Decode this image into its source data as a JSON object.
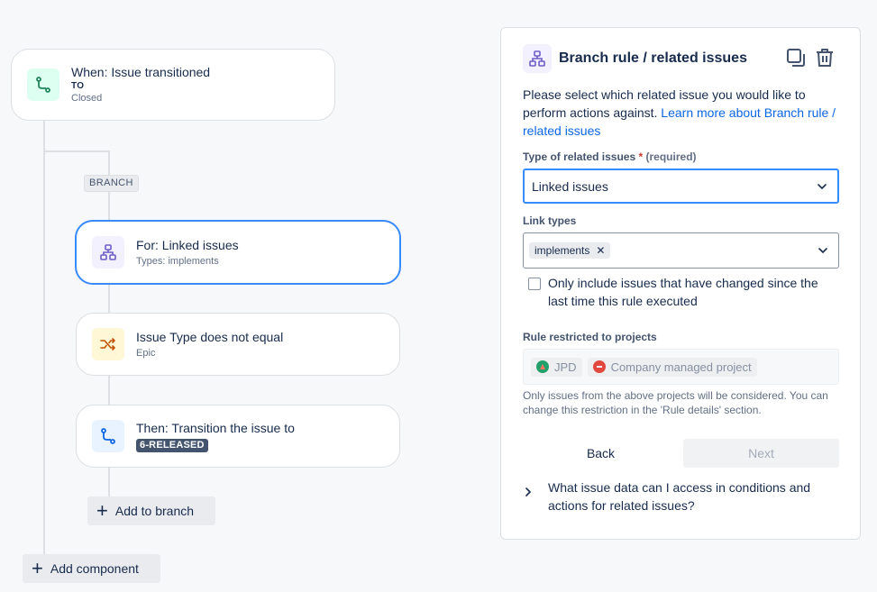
{
  "flow": {
    "trigger": {
      "title": "When: Issue transitioned",
      "to": "TO",
      "status": "Closed"
    },
    "branch_tag": "BRANCH",
    "branch_card": {
      "title": "For: Linked issues",
      "sub": "Types: implements"
    },
    "condition_card": {
      "title": "Issue Type does not equal",
      "sub": "Epic"
    },
    "action_card": {
      "title": "Then: Transition the issue to",
      "lozenge": "6-RELEASED"
    },
    "add_to_branch": "Add to branch",
    "add_component": "Add component"
  },
  "panel": {
    "title": "Branch rule / related issues",
    "description": "Please select which related issue you would like to perform actions against.",
    "learn_more": "Learn more about Branch rule / related issues",
    "type_label": "Type of related issues",
    "required_mark": "*",
    "required_text": "(required)",
    "type_value": "Linked issues",
    "link_types_label": "Link types",
    "link_type_tag": "implements",
    "checkbox_label": "Only include issues that have changed since the last time this rule executed",
    "checkbox_checked": false,
    "projects_label": "Rule restricted to projects",
    "projects": [
      {
        "name": "JPD",
        "color": "#22a06b"
      },
      {
        "name": "Company managed project",
        "color": "#e2483d"
      }
    ],
    "projects_hint": "Only issues from the above projects will be considered. You can change this restriction in the 'Rule details' section.",
    "back_label": "Back",
    "next_label": "Next",
    "faq": "What issue data can I access in conditions and actions for related issues?"
  },
  "colors": {
    "accent": "#388bff",
    "link": "#0c66e4",
    "lozenge_bg": "#44546f"
  }
}
